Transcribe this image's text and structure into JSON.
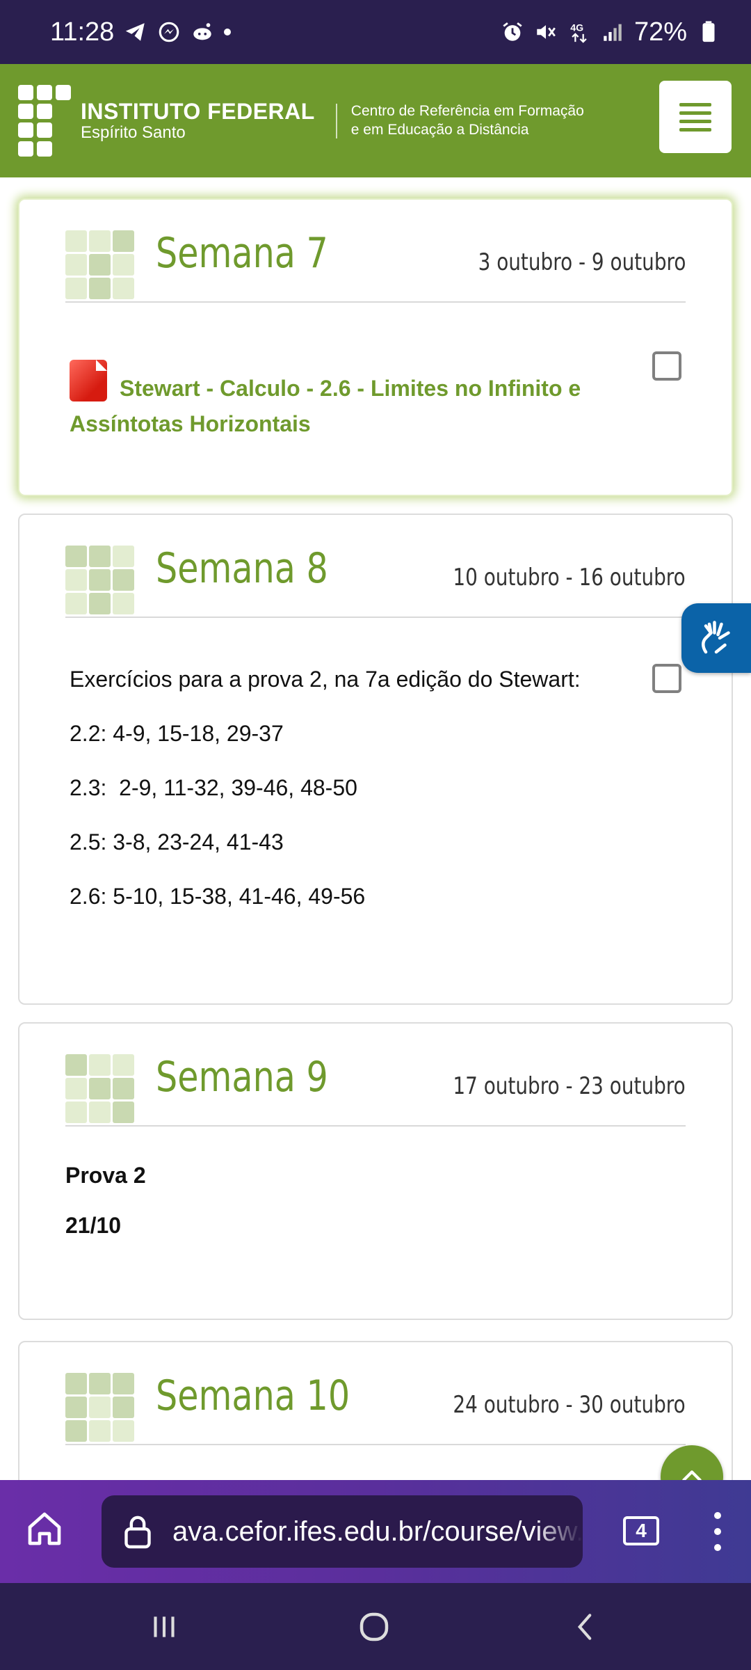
{
  "status_bar": {
    "time": "11:28",
    "battery": "72%",
    "network": "4G",
    "left_icons": [
      "telegram-icon",
      "messenger-icon",
      "reddit-icon",
      "dot-indicator"
    ],
    "right_icons": [
      "alarm-icon",
      "mute-icon",
      "network-4g-icon",
      "signal-icon",
      "battery-icon"
    ]
  },
  "header": {
    "brand_title": "INSTITUTO FEDERAL",
    "brand_subtitle": "Espírito Santo",
    "brand_desc_line1": "Centro de Referência em Formação",
    "brand_desc_line2": "e em Educação a Distância",
    "menu_icon": "hamburger-icon"
  },
  "weeks": [
    {
      "title": "Semana 7",
      "dates": "3 outubro - 9 outubro",
      "resource": {
        "icon": "pdf-icon",
        "label": "Stewart - Calculo - 2.6 - Limites no Infinito e Assíntotas Horizontais"
      }
    },
    {
      "title": "Semana 8",
      "dates": "10 outubro - 16 outubro",
      "lines": [
        "Exercícios para a prova 2, na 7a edição do Stewart:",
        "2.2: 4-9, 15-18, 29-37",
        "2.3:  2-9, 11-32, 39-46, 48-50",
        "2.5: 3-8, 23-24, 41-43",
        "2.6: 5-10, 15-38, 41-46, 49-56"
      ]
    },
    {
      "title": "Semana 9",
      "dates": "17 outubro - 23 outubro",
      "lines": [
        "Prova 2",
        "21/10"
      ]
    },
    {
      "title": "Semana 10",
      "dates": "24 outubro - 30 outubro"
    }
  ],
  "browser": {
    "url": "ava.cefor.ifes.edu.br/course/view.php",
    "tab_count": "4"
  },
  "colors": {
    "brand_green": "#6f9a2d",
    "status_bg": "#2a1f4f",
    "browser_gradient_start": "#6a2ea8",
    "browser_gradient_end": "#3f3a93",
    "accessibility_blue": "#0b63a8"
  }
}
